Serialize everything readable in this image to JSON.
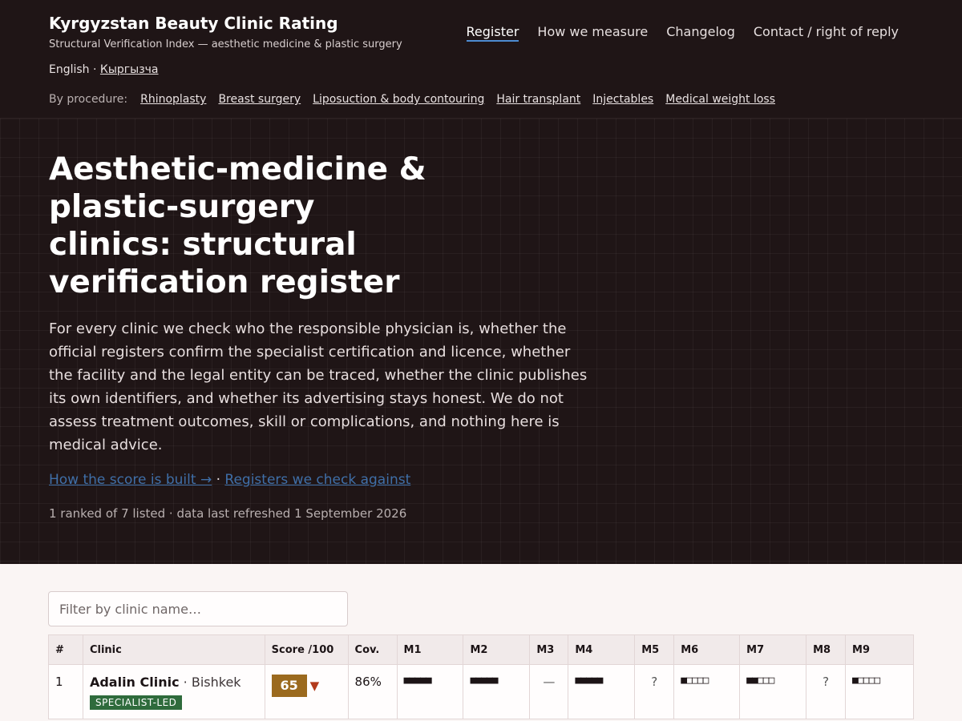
{
  "site": {
    "title": "Kyrgyzstan Beauty Clinic Rating",
    "subtitle": "Structural Verification Index — aesthetic medicine & plastic surgery",
    "lang_current": "English",
    "lang_sep": " · ",
    "lang_other": "Кыргызча"
  },
  "nav": {
    "items": [
      "Register",
      "How we measure",
      "Changelog",
      "Contact / right of reply"
    ]
  },
  "procedures": {
    "label": "By procedure:",
    "items": [
      "Rhinoplasty",
      "Breast surgery",
      "Liposuction & body contouring",
      "Hair transplant",
      "Injectables",
      "Medical weight loss"
    ]
  },
  "hero": {
    "title": "Aesthetic-medicine & plastic-surgery clinics: structural verification register",
    "intro": "For every clinic we check who the responsible physician is, whether the official registers confirm the specialist certification and licence, whether the facility and the legal entity can be traced, whether the clinic publishes its own identifiers, and whether its advertising stays honest. We do not assess treatment outcomes, skill or complications, and nothing here is medical advice.",
    "link1": "How the score is built →",
    "link_sep": " · ",
    "link2": "Registers we check against",
    "meta": "1 ranked of 7 listed · data last refreshed 1 September 2026"
  },
  "filter": {
    "placeholder": "Filter by clinic name…"
  },
  "table": {
    "headers": [
      "#",
      "Clinic",
      "Score /100",
      "Cov.",
      "M1",
      "M2",
      "M3",
      "M4",
      "M5",
      "M6",
      "M7",
      "M8",
      "M9"
    ],
    "rows": [
      {
        "rank": "1",
        "clinic": "Adalin Clinic",
        "city": " · Bishkek",
        "tag": "SPECIALIST-LED",
        "score": "65",
        "trend": "▼",
        "coverage": "86%",
        "m1": "■■■■■",
        "m2": "■■■■■",
        "m3": "—",
        "m4": "■■■■■",
        "m5": "?",
        "m6": "■□□□□",
        "m7": "■■□□□",
        "m8": "?",
        "m9": "■□□□□"
      }
    ]
  },
  "colors": {
    "header_bg": "#1f1516",
    "score_badge": "#9b6a1e",
    "tag_green": "#2f6b3c",
    "trend_down": "#b23a1c",
    "link_blue": "#3f6fa8"
  }
}
